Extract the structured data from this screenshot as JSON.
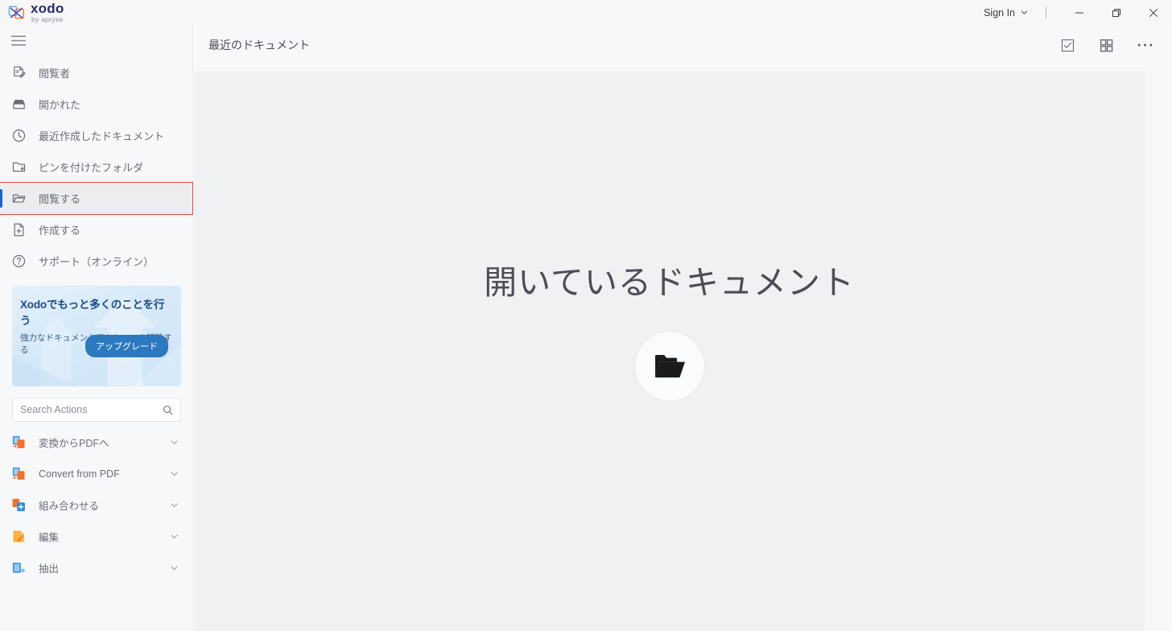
{
  "window": {
    "logo_word": "xodo",
    "logo_sub": "by apryse",
    "sign_in": "Sign In",
    "minimize_label": "Minimize",
    "restore_label": "Restore",
    "close_label": "Close"
  },
  "sidebar": {
    "menu_toggle_label": "Menu",
    "items": [
      {
        "label": "閲覧者",
        "icon": "document-edit-icon",
        "selected": false
      },
      {
        "label": "開かれた",
        "icon": "open-box-icon",
        "selected": false
      },
      {
        "label": "最近作成したドキュメント",
        "icon": "clock-icon",
        "selected": false
      },
      {
        "label": "ピンを付けたフォルダ",
        "icon": "folder-pin-icon",
        "selected": false
      },
      {
        "label": "閲覧する",
        "icon": "open-folder-icon",
        "selected": true
      },
      {
        "label": "作成する",
        "icon": "document-plus-icon",
        "selected": false
      },
      {
        "label": "サポート（オンライン）",
        "icon": "help-circle-icon",
        "selected": false
      }
    ],
    "promo": {
      "title": "Xodoでもっと多くのことを行う",
      "subtitle": "強力なドキュメントアクションを解除する",
      "button": "アップグレード",
      "accent_color": "#2c79bf",
      "title_color": "#1c4a8a"
    },
    "search": {
      "placeholder": "Search Actions",
      "value": "",
      "icon": "search-icon"
    },
    "actions": [
      {
        "label": "変換からPDFへ",
        "icon": "convert-to-pdf-icon",
        "chevron": "chevron-down-icon"
      },
      {
        "label": "Convert from PDF",
        "icon": "convert-from-pdf-icon",
        "chevron": "chevron-down-icon"
      },
      {
        "label": "組み合わせる",
        "icon": "combine-icon",
        "chevron": "chevron-down-icon"
      },
      {
        "label": "編集",
        "icon": "edit-pencil-icon",
        "chevron": "chevron-down-icon"
      },
      {
        "label": "抽出",
        "icon": "extract-icon",
        "chevron": "chevron-down-icon"
      }
    ]
  },
  "main": {
    "title": "最近のドキュメント",
    "tools": [
      {
        "name": "select-checkbox-icon",
        "label": "Select"
      },
      {
        "name": "grid-view-icon",
        "label": "Grid view"
      },
      {
        "name": "more-options-icon",
        "label": "More"
      }
    ],
    "empty_state": {
      "title": "開いているドキュメント",
      "button_icon": "open-folder-icon",
      "button_label": "ドキュメントを開く"
    }
  },
  "colors": {
    "titlebar_bg": "#f6f7f9",
    "sidebar_bg": "#f7f8fa",
    "content_card_bg": "#f0f1f3",
    "selection_accent": "#1b64d4",
    "annotation_outline": "#e8433f",
    "text_muted": "#6b6e76"
  }
}
